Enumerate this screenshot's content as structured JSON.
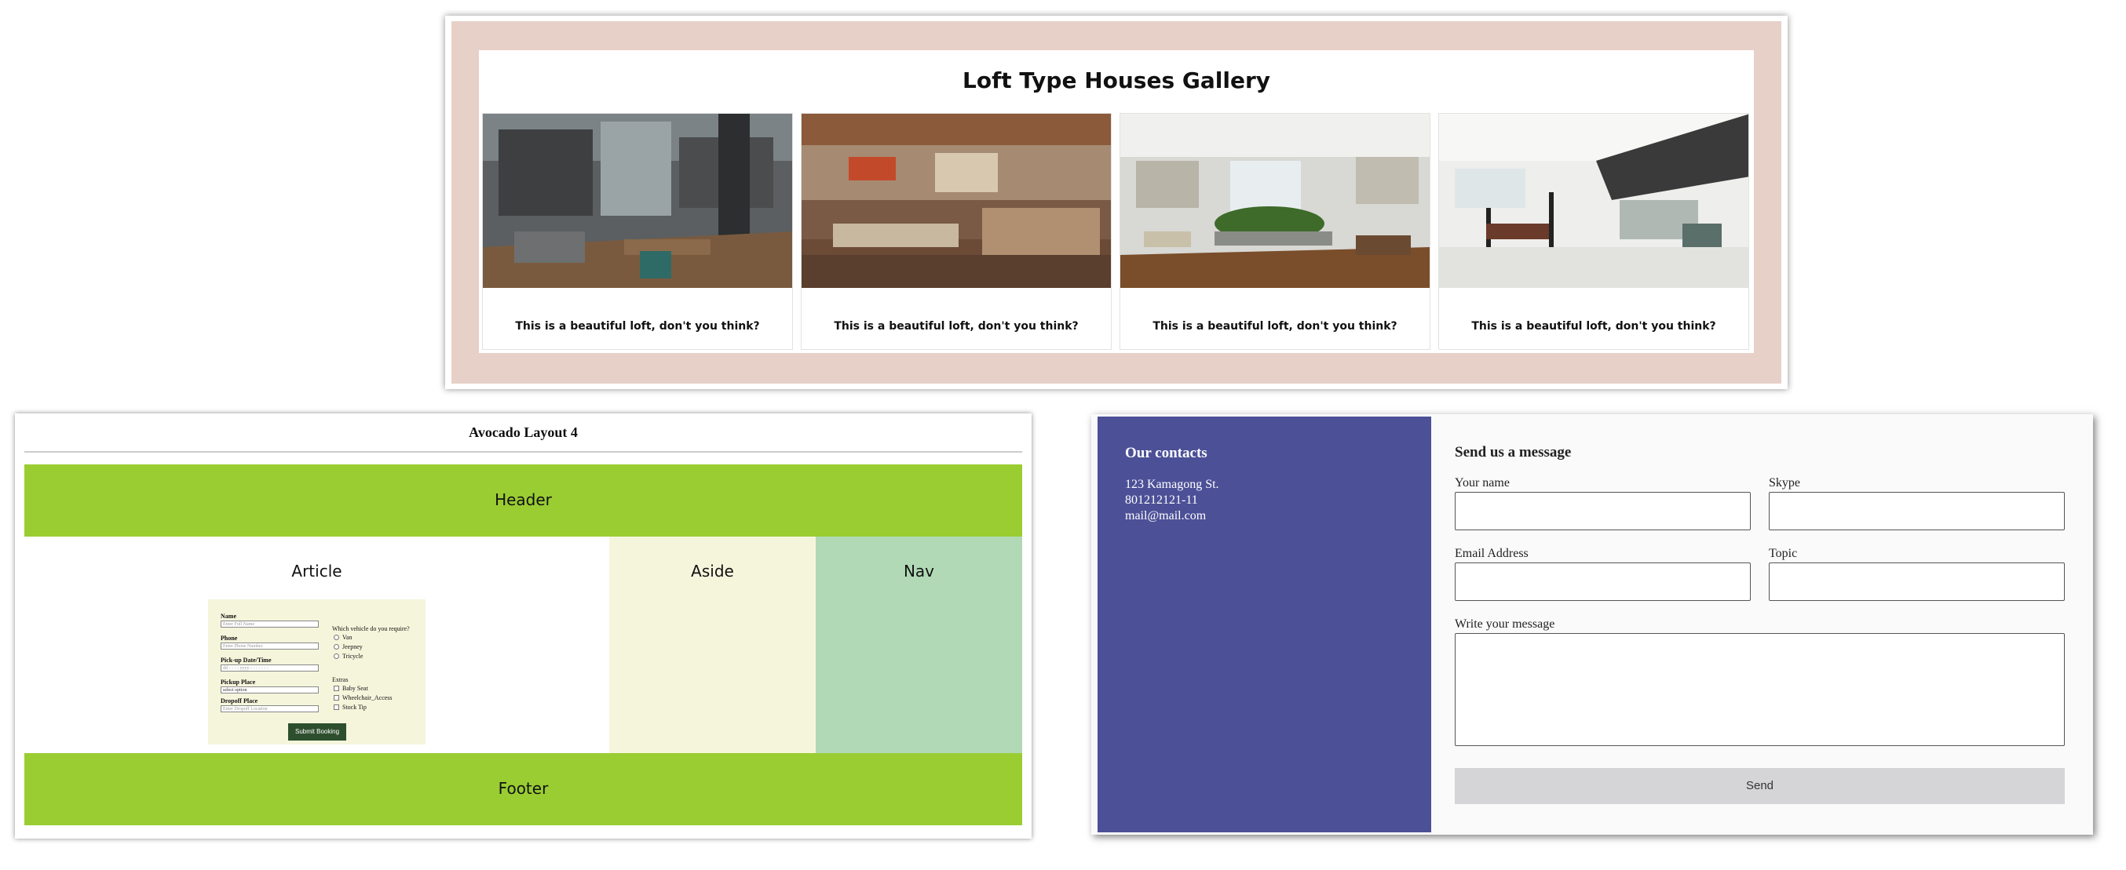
{
  "gallery": {
    "title": "Loft Type Houses Gallery",
    "cards": [
      {
        "caption": "This is a beautiful loft, don't you think?"
      },
      {
        "caption": "This is a beautiful loft, don't you think?"
      },
      {
        "caption": "This is a beautiful loft, don't you think?"
      },
      {
        "caption": "This is a beautiful loft, don't you think?"
      }
    ],
    "colors": {
      "frame": "#e7d0c8"
    }
  },
  "avocado": {
    "title": "Avocado Layout 4",
    "header": "Header",
    "article": "Article",
    "aside": "Aside",
    "nav": "Nav",
    "footer": "Footer",
    "colors": {
      "header": "#9acd32",
      "aside": "#f5f5dc",
      "nav": "#b1d9b6"
    },
    "form": {
      "name_label": "Name",
      "name_placeholder": "Enter Full Name",
      "phone_label": "Phone",
      "phone_placeholder": "Enter Phone Number",
      "pickup_dt_label": "Pick-up Date/Time",
      "pickup_dt_value": "dd - - - - yyyy   - - : - -   - -",
      "pickup_place_label": "Pickup Place",
      "pickup_place_value": "select option",
      "dropoff_label": "Dropoff Place",
      "dropoff_placeholder": "Enter Dropoff Location",
      "vehicle_question": "Which vehicle do you require?",
      "vehicles": [
        "Van",
        "Jeepney",
        "Tricycle"
      ],
      "extras_label": "Extras",
      "extras": [
        "Baby Seat",
        "Wheelchair_Access",
        "Stock Tip"
      ],
      "submit_label": "Submit Booking"
    }
  },
  "contact": {
    "sidebar_title": "Our contacts",
    "address": "123 Kamagong St.",
    "phone": "801212121-11",
    "email": "mail@mail.com",
    "form_title": "Send us a message",
    "labels": {
      "name": "Your name",
      "skype": "Skype",
      "email": "Email Address",
      "topic": "Topic",
      "message": "Write your message"
    },
    "send_label": "Send",
    "colors": {
      "sidebar": "#4c5097",
      "button": "#d5d4d6"
    }
  }
}
